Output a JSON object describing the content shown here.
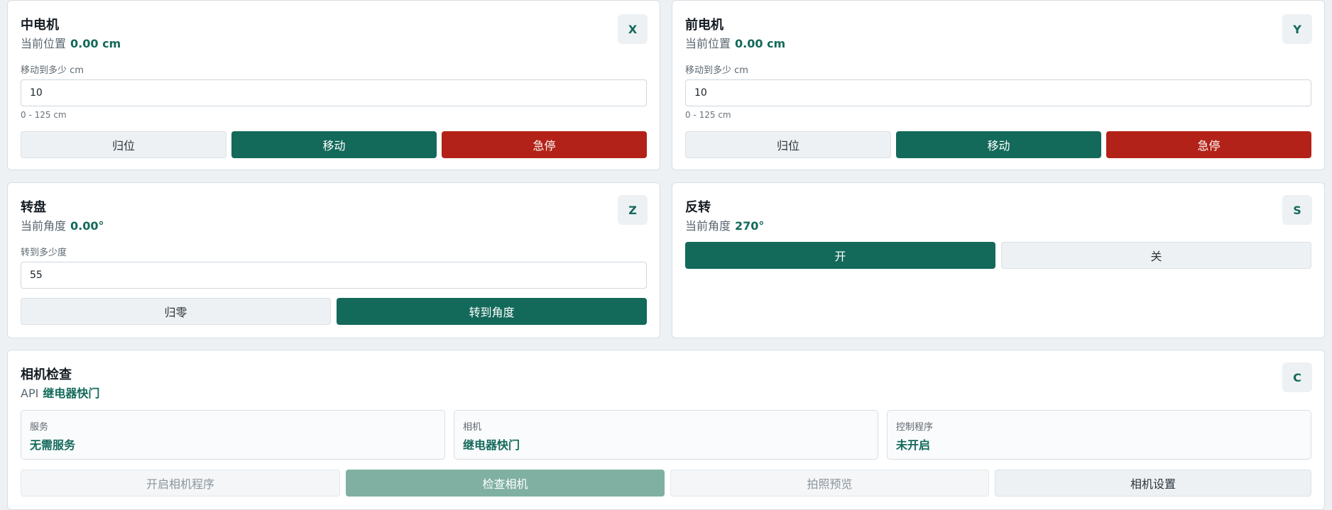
{
  "middle_motor": {
    "title": "中电机",
    "position_label": "当前位置",
    "position_value": "0.00 cm",
    "axis": "X",
    "input_label": "移动到多少 cm",
    "input_value": "10",
    "range_hint": "0 - 125 cm",
    "home_label": "归位",
    "move_label": "移动",
    "stop_label": "急停"
  },
  "front_motor": {
    "title": "前电机",
    "position_label": "当前位置",
    "position_value": "0.00 cm",
    "axis": "Y",
    "input_label": "移动到多少 cm",
    "input_value": "10",
    "range_hint": "0 - 125 cm",
    "home_label": "归位",
    "move_label": "移动",
    "stop_label": "急停"
  },
  "turntable": {
    "title": "转盘",
    "angle_label": "当前角度",
    "angle_value": "0.00°",
    "axis": "Z",
    "input_label": "转到多少度",
    "input_value": "55",
    "zero_label": "归零",
    "rotate_label": "转到角度"
  },
  "flip": {
    "title": "反转",
    "angle_label": "当前角度",
    "angle_value": "270°",
    "axis": "S",
    "on_label": "开",
    "off_label": "关"
  },
  "camera": {
    "title": "相机检查",
    "api_label": "API",
    "api_value": "继电器快门",
    "axis": "C",
    "stats": [
      {
        "key": "服务",
        "value": "无需服务"
      },
      {
        "key": "相机",
        "value": "继电器快门"
      },
      {
        "key": "控制程序",
        "value": "未开启"
      }
    ],
    "start_label": "开启相机程序",
    "check_label": "检查相机",
    "preview_label": "拍照预览",
    "settings_label": "相机设置"
  },
  "colors": {
    "accent": "#13695a",
    "danger": "#b32218"
  }
}
